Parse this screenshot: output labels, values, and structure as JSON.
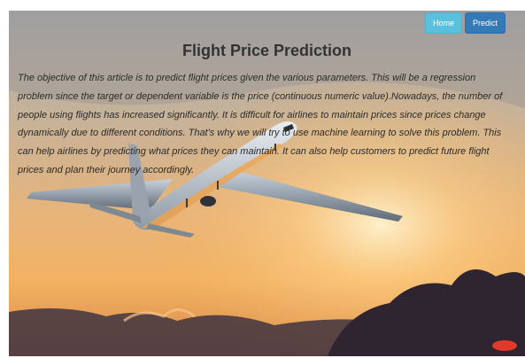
{
  "nav": {
    "home_label": "Home",
    "predict_label": "Predict"
  },
  "page": {
    "title": "Flight Price Prediction",
    "description": "The objective of this article is to predict flight prices given the various parameters. This will be a regression problem since the target or dependent variable is the price (continuous numeric value).Nowadays, the number of people using flights has increased significantly. It is difficult for airlines to maintain prices since prices change dynamically due to different conditions. That's why we will try to use machine learning to solve this problem. This can help airlines by predicting what prices they can maintain. It can also help customers to predict future flight prices and plan their journey accordingly."
  },
  "colors": {
    "home_button": "#5bc0de",
    "predict_button": "#337ab7",
    "title_text": "#333333",
    "sky_top": "#a9a9aa",
    "sky_sunset": "#f2b262"
  },
  "icons": {
    "background": "airplane-sunset-image"
  }
}
